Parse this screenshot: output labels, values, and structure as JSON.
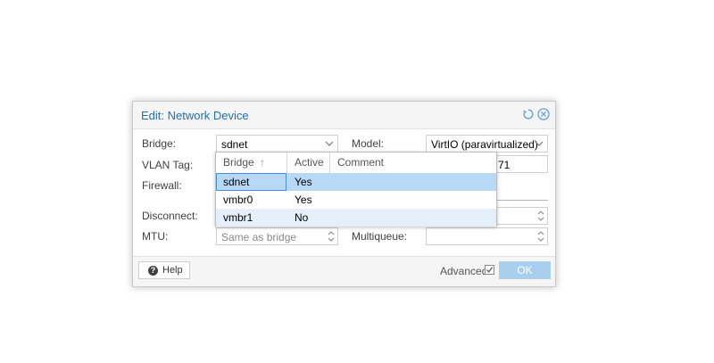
{
  "dialog": {
    "title": "Edit: Network Device",
    "icons": {
      "reset": "reset-icon",
      "close": "close-icon"
    }
  },
  "form": {
    "bridge": {
      "label": "Bridge:",
      "value": "sdnet"
    },
    "vlan_tag": {
      "label": "VLAN Tag:"
    },
    "firewall": {
      "label": "Firewall:"
    },
    "model": {
      "label": "Model:",
      "value": "VirtIO (paravirtualized)"
    },
    "mac_partial": "71",
    "disconnect": {
      "label": "Disconnect:"
    },
    "mtu": {
      "label": "MTU:",
      "placeholder": "Same as bridge"
    },
    "multiqueue": {
      "label": "Multiqueue:"
    }
  },
  "bridge_picker": {
    "columns": [
      "Bridge",
      "Active",
      "Comment"
    ],
    "sort_indicator": "↑",
    "rows": [
      {
        "bridge": "sdnet",
        "active": "Yes",
        "comment": ""
      },
      {
        "bridge": "vmbr0",
        "active": "Yes",
        "comment": ""
      },
      {
        "bridge": "vmbr1",
        "active": "No",
        "comment": ""
      }
    ]
  },
  "footer": {
    "help_label": "Help",
    "advanced_label": "Advanced",
    "advanced_checked": true,
    "ok_label": "OK"
  },
  "colors": {
    "title": "#1f6fb3",
    "accent": "#5fa2dd",
    "ok_button": "#a9cfef",
    "selected_row": "#b7d9f5",
    "alt_row": "#e4eff9"
  }
}
